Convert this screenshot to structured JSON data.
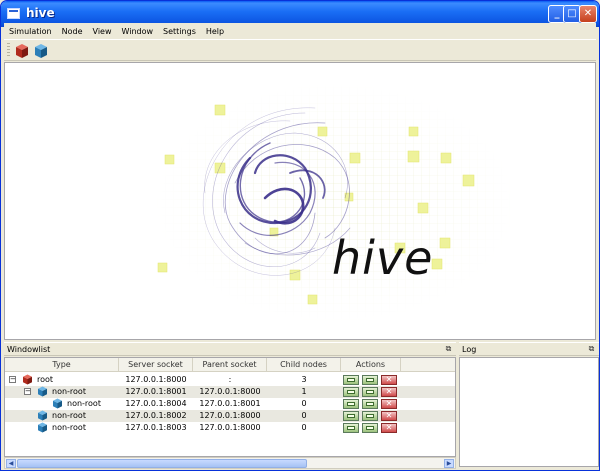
{
  "window": {
    "title": "hive"
  },
  "titlebar": {
    "minimize": "_",
    "maximize": "□",
    "close": "✕"
  },
  "menu": [
    "Simulation",
    "Node",
    "View",
    "Window",
    "Settings",
    "Help"
  ],
  "toolbar": {
    "tools": [
      "new-root-node",
      "new-non-root-node"
    ]
  },
  "splash": {
    "logo_text": "hive"
  },
  "windowlist": {
    "title": "Windowlist",
    "columns": [
      "Type",
      "Server socket",
      "Parent socket",
      "Child nodes",
      "Actions"
    ],
    "rows": [
      {
        "type": "root",
        "server": "127.0.0.1:8000",
        "parent": ":",
        "children": "3",
        "level": 0,
        "expander": "−",
        "icon": "red"
      },
      {
        "type": "non-root",
        "server": "127.0.0.1:8001",
        "parent": "127.0.0.1:8000",
        "children": "1",
        "level": 1,
        "expander": "−",
        "icon": "blue"
      },
      {
        "type": "non-root",
        "server": "127.0.0.1:8004",
        "parent": "127.0.0.1:8001",
        "children": "0",
        "level": 2,
        "expander": "",
        "icon": "blue"
      },
      {
        "type": "non-root",
        "server": "127.0.0.1:8002",
        "parent": "127.0.0.1:8000",
        "children": "0",
        "level": 1,
        "expander": "",
        "icon": "blue"
      },
      {
        "type": "non-root",
        "server": "127.0.0.1:8003",
        "parent": "127.0.0.1:8000",
        "children": "0",
        "level": 1,
        "expander": "",
        "icon": "blue"
      }
    ]
  },
  "log": {
    "title": "Log"
  },
  "colors": {
    "titlebar": "#0A5CF2",
    "root_icon": "#C0392B",
    "nonroot_icon": "#2C7FB8",
    "swirl": "#3a2f8a"
  }
}
